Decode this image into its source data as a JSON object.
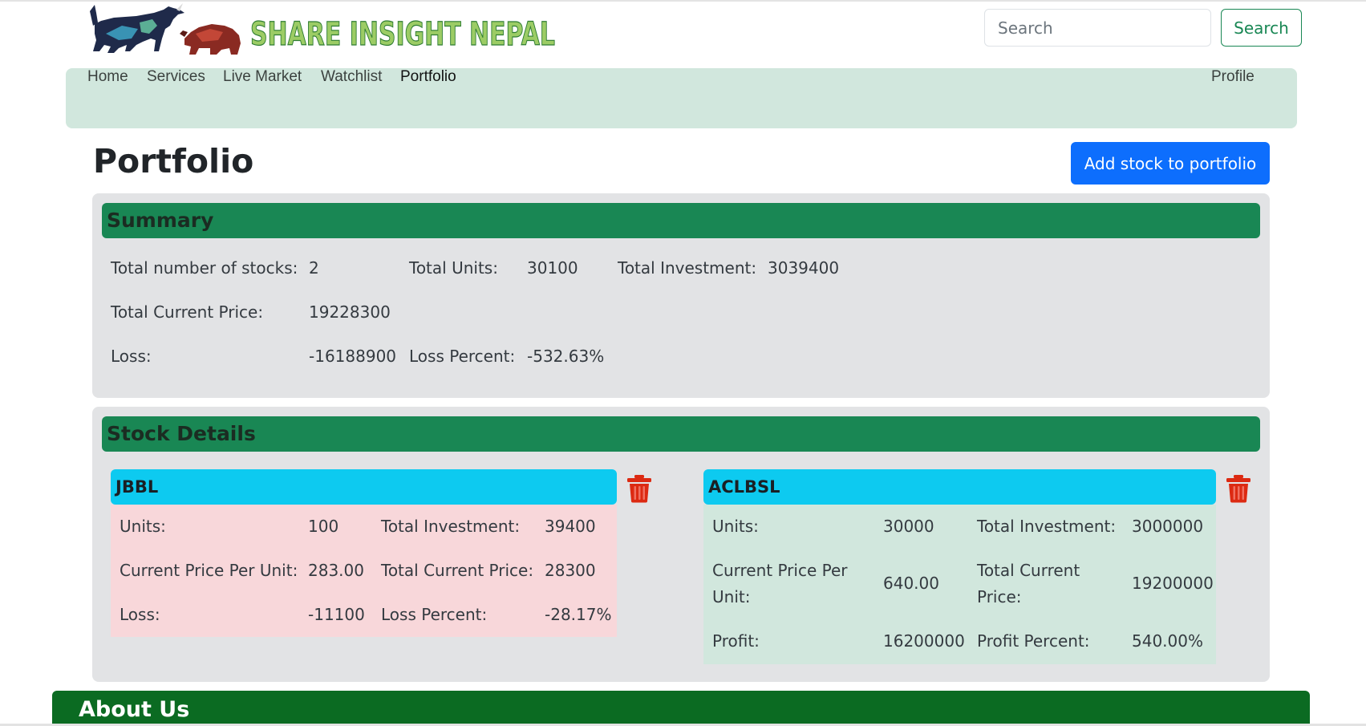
{
  "brand": {
    "logo_text": "SHARE INSIGHT NEPAL"
  },
  "search": {
    "placeholder": "Search",
    "button_label": "Search"
  },
  "nav": {
    "items": [
      "Home",
      "Services",
      "Live Market",
      "Watchlist",
      "Portfolio"
    ],
    "active": "Portfolio",
    "profile_label": "Profile"
  },
  "page": {
    "title": "Portfolio",
    "add_button_label": "Add stock to portfolio"
  },
  "summary": {
    "header": "Summary",
    "total_stocks_label": "Total number of stocks:",
    "total_stocks_value": "2",
    "total_units_label": "Total Units:",
    "total_units_value": "30100",
    "total_investment_label": "Total Investment:",
    "total_investment_value": "3039400",
    "total_current_price_label": "Total Current Price:",
    "total_current_price_value": "19228300",
    "loss_label": "Loss:",
    "loss_value": "-16188900",
    "loss_percent_label": "Loss Percent:",
    "loss_percent_value": "-532.63%"
  },
  "details": {
    "header": "Stock Details",
    "stocks": [
      {
        "symbol": "JBBL",
        "status": "loss",
        "units_label": "Units:",
        "units": "100",
        "investment_label": "Total Investment:",
        "investment": "39400",
        "price_label": "Current Price Per Unit:",
        "price": "283.00",
        "total_current_label": "Total Current Price:",
        "total_current": "28300",
        "pl_label": "Loss:",
        "pl": "-11100",
        "pl_percent_label": "Loss Percent:",
        "pl_percent": "-28.17%"
      },
      {
        "symbol": "ACLBSL",
        "status": "profit",
        "units_label": "Units:",
        "units": "30000",
        "investment_label": "Total Investment:",
        "investment": "3000000",
        "price_label_line1": "Current Price Per",
        "price_label_line2": "Unit:",
        "price": "640.00",
        "total_current_label_line1": "Total Current",
        "total_current_label_line2": "Price:",
        "total_current": "19200000",
        "pl_label": "Profit:",
        "pl": "16200000",
        "pl_percent_label": "Profit Percent:",
        "pl_percent": "540.00%"
      }
    ]
  },
  "footer": {
    "title": "About Us"
  },
  "colors": {
    "navbar_bg": "#d1e7dd",
    "success": "#198754",
    "primary": "#0d6efd",
    "info": "#0dcaf0",
    "loss_bg": "#f8d7da",
    "profit_bg": "#d1e7dd",
    "danger": "#dc3545",
    "footer": "#0b6b22"
  },
  "icons": {
    "delete": "trash-icon",
    "logo_animals": [
      "bull-icon",
      "bear-icon"
    ]
  }
}
